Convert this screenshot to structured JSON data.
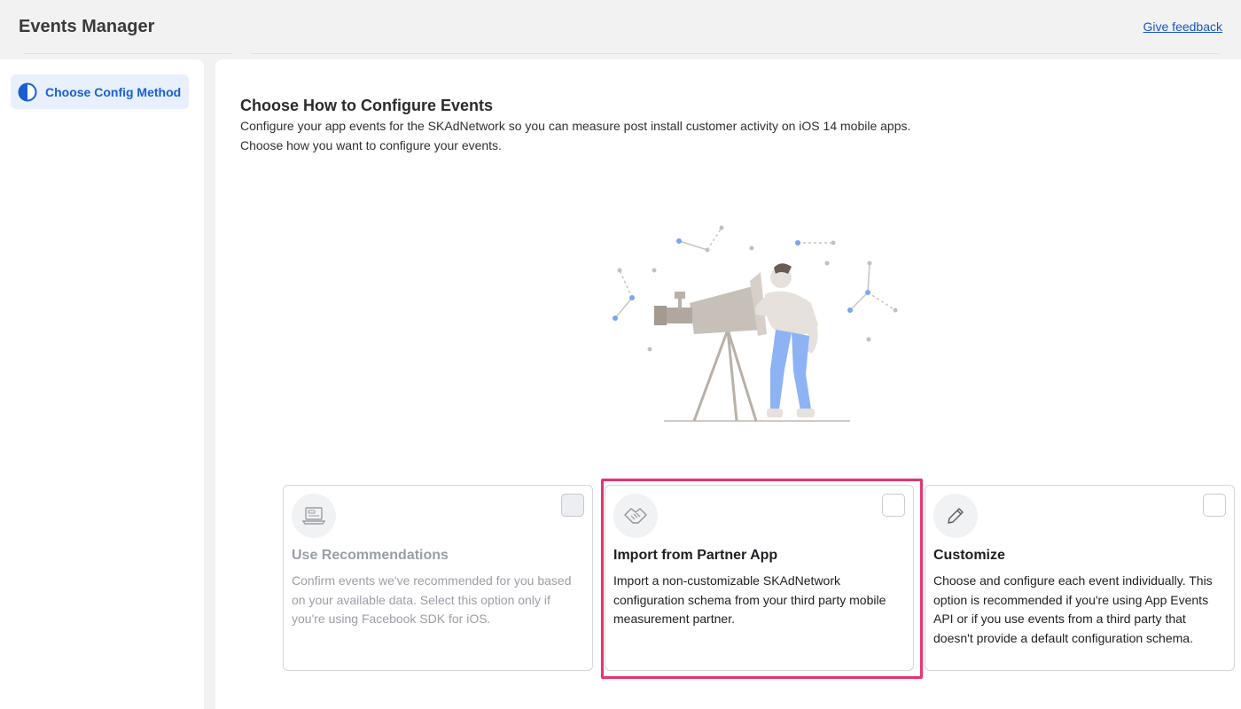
{
  "header": {
    "app_title": "Events Manager",
    "feedback_link": "Give feedback"
  },
  "sidebar": {
    "items": [
      {
        "label": "Choose Config Method",
        "icon": "half-circle-icon",
        "active": true
      }
    ]
  },
  "main": {
    "title": "Choose How to Configure Events",
    "description_line1": "Configure your app events for the SKAdNetwork so you can measure post install customer activity on iOS 14 mobile apps.",
    "description_line2": "Choose how you want to configure your events.",
    "illustration": "person-with-telescope-illustration"
  },
  "options": [
    {
      "title": "Use Recommendations",
      "description": "Confirm events we've recommended for you based on your available data. Select this option only if you're using Facebook SDK for iOS.",
      "icon": "laptop-icon",
      "disabled": true
    },
    {
      "title": "Import from Partner App",
      "description": "Import a non-customizable SKAdNetwork configuration schema from your third party mobile measurement partner.",
      "icon": "handshake-icon",
      "highlighted": true
    },
    {
      "title": "Customize",
      "description": "Choose and configure each event individually. This option is recommended if you're using App Events API or if you use events from a third party that doesn't provide a default configuration schema.",
      "icon": "pencil-icon"
    }
  ],
  "colors": {
    "accent": "#1a5fd0",
    "highlight_border": "#e8336d",
    "sidebar_active_bg": "#e7f0fc"
  }
}
